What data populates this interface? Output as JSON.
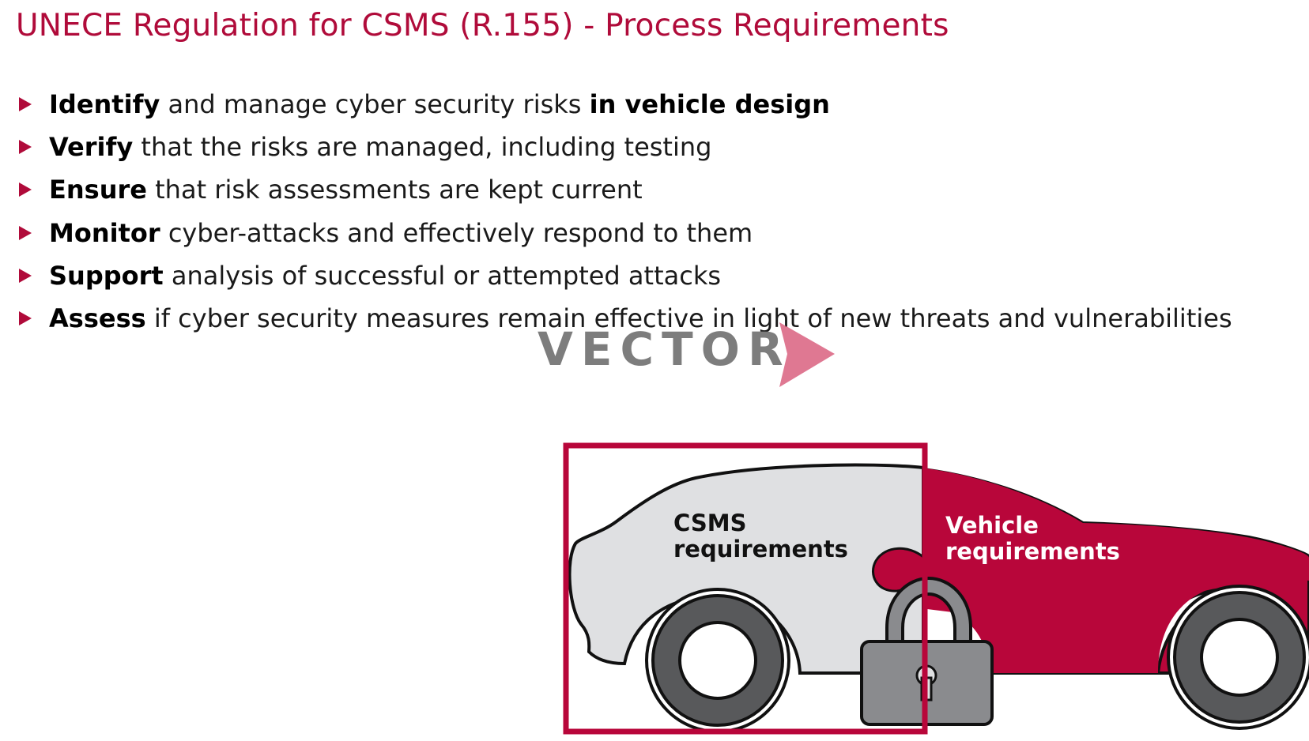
{
  "title": "UNECE Regulation for CSMS (R.155) - Process Requirements",
  "bullets": [
    {
      "parts": [
        {
          "text": "Identify",
          "bold": true
        },
        {
          "text": " and manage cyber security risks ",
          "bold": false
        },
        {
          "text": "in vehicle design",
          "bold": true
        }
      ]
    },
    {
      "parts": [
        {
          "text": "Verify",
          "bold": true
        },
        {
          "text": " that the risks are managed, including testing",
          "bold": false
        }
      ]
    },
    {
      "parts": [
        {
          "text": "Ensure",
          "bold": true
        },
        {
          "text": " that risk assessments are kept current",
          "bold": false
        }
      ]
    },
    {
      "parts": [
        {
          "text": "Monitor",
          "bold": true
        },
        {
          "text": " cyber-attacks and effectively respond to them",
          "bold": false
        }
      ]
    },
    {
      "parts": [
        {
          "text": "Support",
          "bold": true
        },
        {
          "text": " analysis of successful or attempted attacks",
          "bold": false
        }
      ]
    },
    {
      "parts": [
        {
          "text": "Assess",
          "bold": true
        },
        {
          "text": " if cyber security measures remain effective in light of new threats and vulnerabilities",
          "bold": false
        }
      ]
    }
  ],
  "logo": {
    "text": "VECTOR",
    "word_color": "#777777",
    "chevron_color": "#d9607f"
  },
  "illustration": {
    "csms_label_line1": "CSMS",
    "csms_label_line2": "requirements",
    "vehicle_label_line1": "Vehicle",
    "vehicle_label_line2": "requirements"
  },
  "colors": {
    "accent": "#b00b3a",
    "car_grey": "#dfe0e2",
    "lock_grey": "#8a8b8e",
    "tire": "#58595b"
  }
}
